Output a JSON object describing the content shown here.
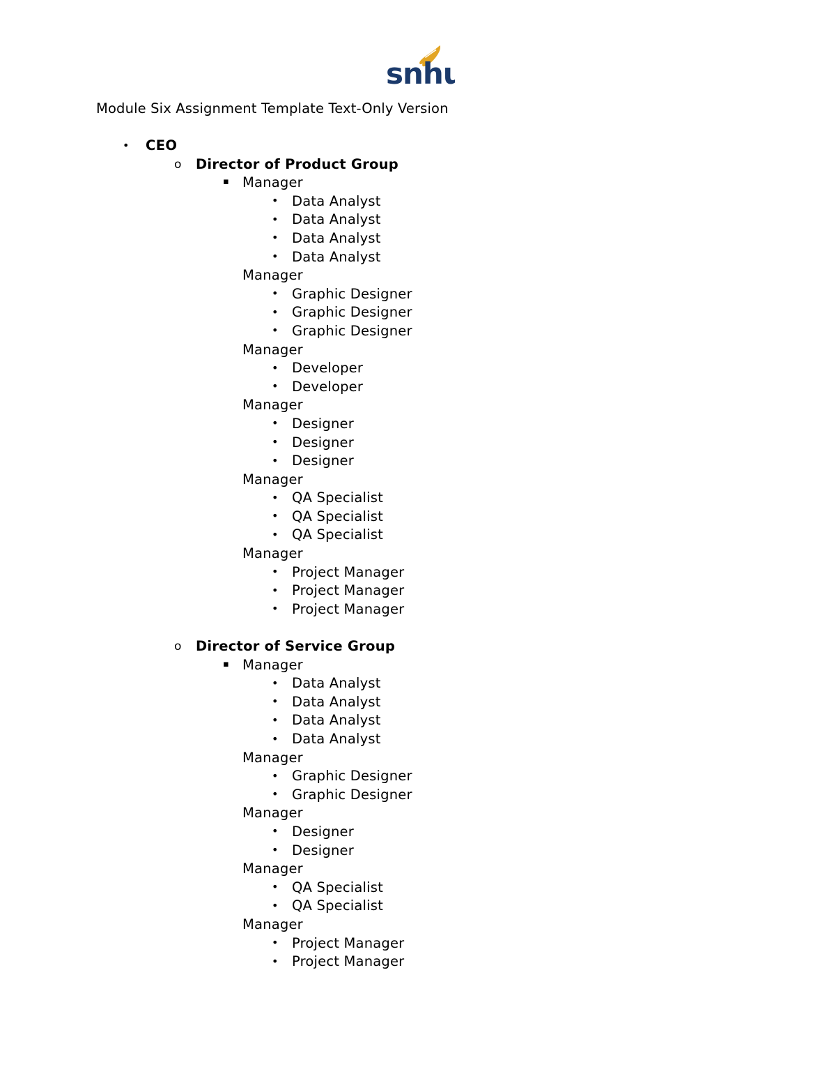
{
  "document": {
    "title": "Module Six Assignment Template Text-Only Version",
    "page_background": "#ffffff",
    "text_color": "#000000"
  },
  "logo": {
    "name": "snhu-logo",
    "wordmark": "snhu",
    "wordmark_color": "#1B3A6B",
    "flame_color": "#E3A523",
    "alt_text": "SNHU"
  },
  "markers": {
    "level1": "•",
    "level2": "o",
    "level3": "▪",
    "level4": "•"
  },
  "outline": [
    {
      "level": 1,
      "marker": true,
      "text": "CEO"
    },
    {
      "level": 2,
      "marker": true,
      "text": "Director of Product Group"
    },
    {
      "level": 3,
      "marker": true,
      "text": "Manager"
    },
    {
      "level": 4,
      "marker": true,
      "text": "Data Analyst"
    },
    {
      "level": 4,
      "marker": true,
      "text": "Data Analyst"
    },
    {
      "level": 4,
      "marker": true,
      "text": "Data Analyst"
    },
    {
      "level": 4,
      "marker": true,
      "text": "Data Analyst"
    },
    {
      "level": 3,
      "marker": false,
      "text": "Manager"
    },
    {
      "level": 4,
      "marker": true,
      "text": "Graphic Designer"
    },
    {
      "level": 4,
      "marker": true,
      "text": "Graphic Designer"
    },
    {
      "level": 4,
      "marker": true,
      "text": "Graphic Designer"
    },
    {
      "level": 3,
      "marker": false,
      "text": "Manager"
    },
    {
      "level": 4,
      "marker": true,
      "text": "Developer"
    },
    {
      "level": 4,
      "marker": true,
      "text": "Developer"
    },
    {
      "level": 3,
      "marker": false,
      "text": "Manager"
    },
    {
      "level": 4,
      "marker": true,
      "text": "Designer"
    },
    {
      "level": 4,
      "marker": true,
      "text": "Designer"
    },
    {
      "level": 4,
      "marker": true,
      "text": "Designer"
    },
    {
      "level": 3,
      "marker": false,
      "text": "Manager"
    },
    {
      "level": 4,
      "marker": true,
      "text": "QA Specialist"
    },
    {
      "level": 4,
      "marker": true,
      "text": "QA Specialist"
    },
    {
      "level": 4,
      "marker": true,
      "text": "QA Specialist"
    },
    {
      "level": 3,
      "marker": false,
      "text": "Manager"
    },
    {
      "level": 4,
      "marker": true,
      "text": "Project Manager"
    },
    {
      "level": 4,
      "marker": true,
      "text": "Project Manager"
    },
    {
      "level": 4,
      "marker": true,
      "text": "Project Manager"
    },
    {
      "level": 0,
      "marker": false,
      "text": ""
    },
    {
      "level": 2,
      "marker": true,
      "text": "Director of Service Group"
    },
    {
      "level": 3,
      "marker": true,
      "text": "Manager"
    },
    {
      "level": 4,
      "marker": true,
      "text": "Data Analyst"
    },
    {
      "level": 4,
      "marker": true,
      "text": "Data Analyst"
    },
    {
      "level": 4,
      "marker": true,
      "text": "Data Analyst"
    },
    {
      "level": 4,
      "marker": true,
      "text": "Data Analyst"
    },
    {
      "level": 3,
      "marker": false,
      "text": "Manager"
    },
    {
      "level": 4,
      "marker": true,
      "text": "Graphic Designer"
    },
    {
      "level": 4,
      "marker": true,
      "text": "Graphic Designer"
    },
    {
      "level": 3,
      "marker": false,
      "text": "Manager"
    },
    {
      "level": 4,
      "marker": true,
      "text": "Designer"
    },
    {
      "level": 4,
      "marker": true,
      "text": "Designer"
    },
    {
      "level": 3,
      "marker": false,
      "text": "Manager"
    },
    {
      "level": 4,
      "marker": true,
      "text": "QA Specialist"
    },
    {
      "level": 4,
      "marker": true,
      "text": "QA Specialist"
    },
    {
      "level": 3,
      "marker": false,
      "text": "Manager"
    },
    {
      "level": 4,
      "marker": true,
      "text": "Project Manager"
    },
    {
      "level": 4,
      "marker": true,
      "text": "Project Manager"
    }
  ]
}
